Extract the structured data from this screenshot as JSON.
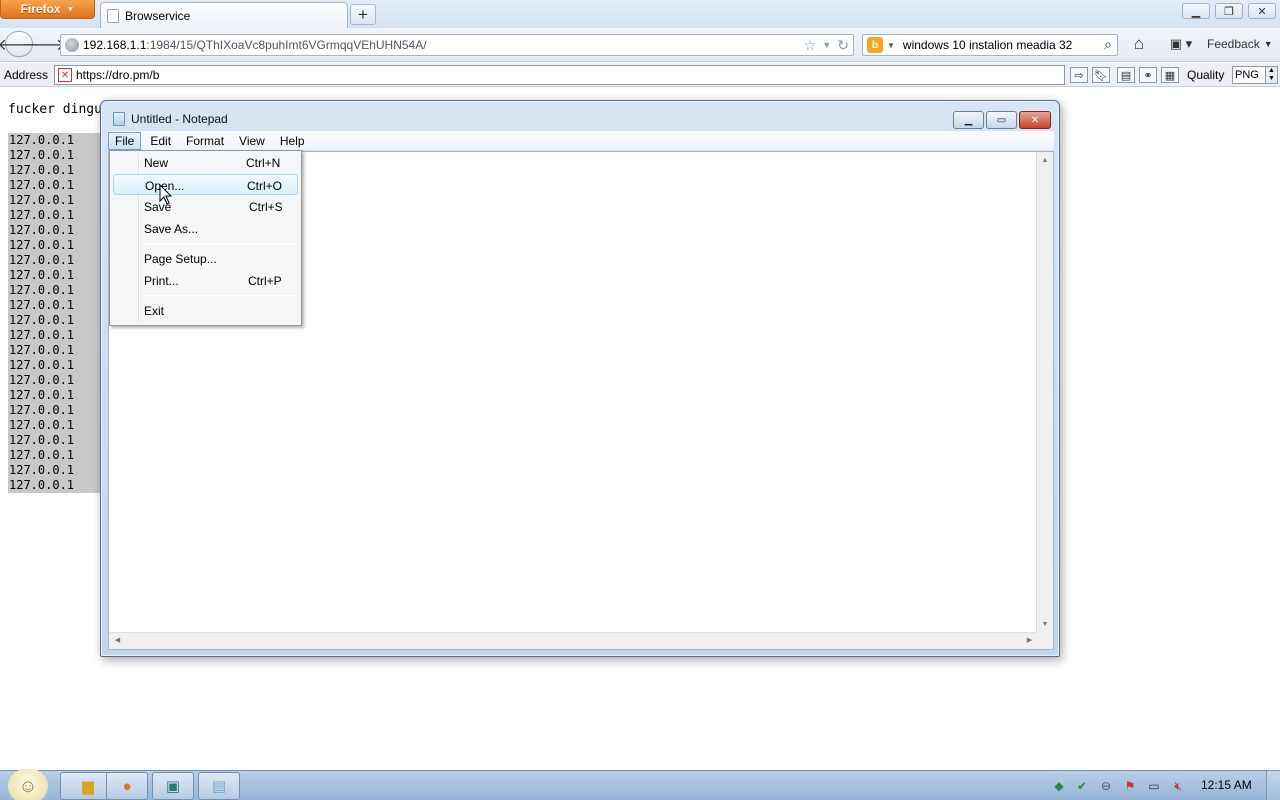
{
  "browser": {
    "menu_button": "Firefox",
    "tab_title": "Browservice",
    "new_tab": "+",
    "window_controls": [
      "minimize-icon",
      "restore-icon",
      "close-icon"
    ],
    "url_host": "192.168.1.1",
    "url_path": ":1984/15/QThIXoaVc8puhImt6VGrmqqVEhUHN54A/",
    "search_value": "windows 10 instalion meadia 32",
    "feedback_label": "Feedback",
    "address_label": "Address",
    "address_value": "https://dro.pm/b",
    "quality_label": "Quality",
    "quality_value": "PNG"
  },
  "page": {
    "heading": "fucker dingu",
    "ip_lines": [
      "127.0.0.1",
      "127.0.0.1",
      "127.0.0.1",
      "127.0.0.1",
      "127.0.0.1",
      "127.0.0.1",
      "127.0.0.1",
      "127.0.0.1",
      "127.0.0.1",
      "127.0.0.1",
      "127.0.0.1",
      "127.0.0.1",
      "127.0.0.1",
      "127.0.0.1",
      "127.0.0.1",
      "127.0.0.1",
      "127.0.0.1",
      "127.0.0.1",
      "127.0.0.1",
      "127.0.0.1",
      "127.0.0.1",
      "127.0.0.1",
      "127.0.0.1",
      "127.0.0.1"
    ]
  },
  "notepad": {
    "title": "Untitled - Notepad",
    "menus": [
      "File",
      "Edit",
      "Format",
      "View",
      "Help"
    ],
    "file_menu": [
      {
        "label": "New",
        "shortcut": "Ctrl+N"
      },
      {
        "label": "Open...",
        "shortcut": "Ctrl+O"
      },
      {
        "label": "Save",
        "shortcut": "Ctrl+S"
      },
      {
        "label": "Save As...",
        "shortcut": ""
      },
      {
        "label": "Page Setup...",
        "shortcut": ""
      },
      {
        "label": "Print...",
        "shortcut": "Ctrl+P"
      },
      {
        "label": "Exit",
        "shortcut": ""
      }
    ],
    "highlighted_item": "Open..."
  },
  "taskbar": {
    "clock": "12:15 AM"
  },
  "colors": {
    "firefox_orange": "#e0721c",
    "selection_gray": "#c8c8c8",
    "menu_hover": "#dcf0fa"
  }
}
